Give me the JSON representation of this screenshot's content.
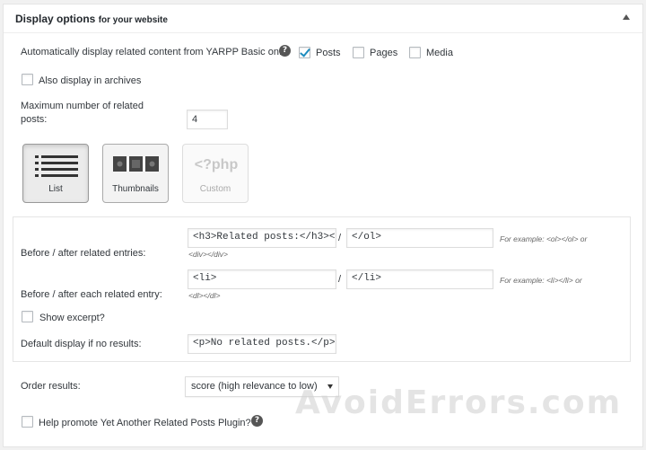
{
  "header": {
    "title": "Display options",
    "subtitle": "for your website"
  },
  "auto_display": {
    "label": "Automatically display related content from YARPP Basic on:",
    "posts_label": "Posts",
    "posts_checked": true,
    "pages_label": "Pages",
    "pages_checked": false,
    "media_label": "Media",
    "media_checked": false
  },
  "archives": {
    "label": "Also display in archives",
    "checked": false
  },
  "max_related": {
    "label_line1": "Maximum number of related",
    "label_line2": "posts:",
    "value": "4"
  },
  "templates": {
    "list_label": "List",
    "thumbnails_label": "Thumbnails",
    "custom_icon_text": "<?php",
    "custom_label": "Custom"
  },
  "related_entries": {
    "label": "Before / after related entries:",
    "before_value": "<h3>Related posts:</h3><",
    "after_value": "</ol>",
    "example_line1": "For example: <ol></ol> or",
    "example_line2": "<div></div>"
  },
  "each_entry": {
    "label": "Before / after each related entry:",
    "before_value": "<li>",
    "after_value": "</li>",
    "example_line1": "For example: <li></li> or",
    "example_line2": "<dl></dl>"
  },
  "slash": "/",
  "excerpt": {
    "label": "Show excerpt?",
    "checked": false
  },
  "no_results": {
    "label": "Default display if no results:",
    "value": "<p>No related posts.</p>"
  },
  "order": {
    "label": "Order results:",
    "selected": "score (high relevance to low)"
  },
  "promote": {
    "label": "Help promote Yet Another Related Posts Plugin?",
    "checked": false
  },
  "watermark": "AvoidErrors.com",
  "colors": {
    "accent": "#1e8cbe",
    "panel_bg": "#ffffff",
    "page_bg": "#f1f1f1"
  }
}
